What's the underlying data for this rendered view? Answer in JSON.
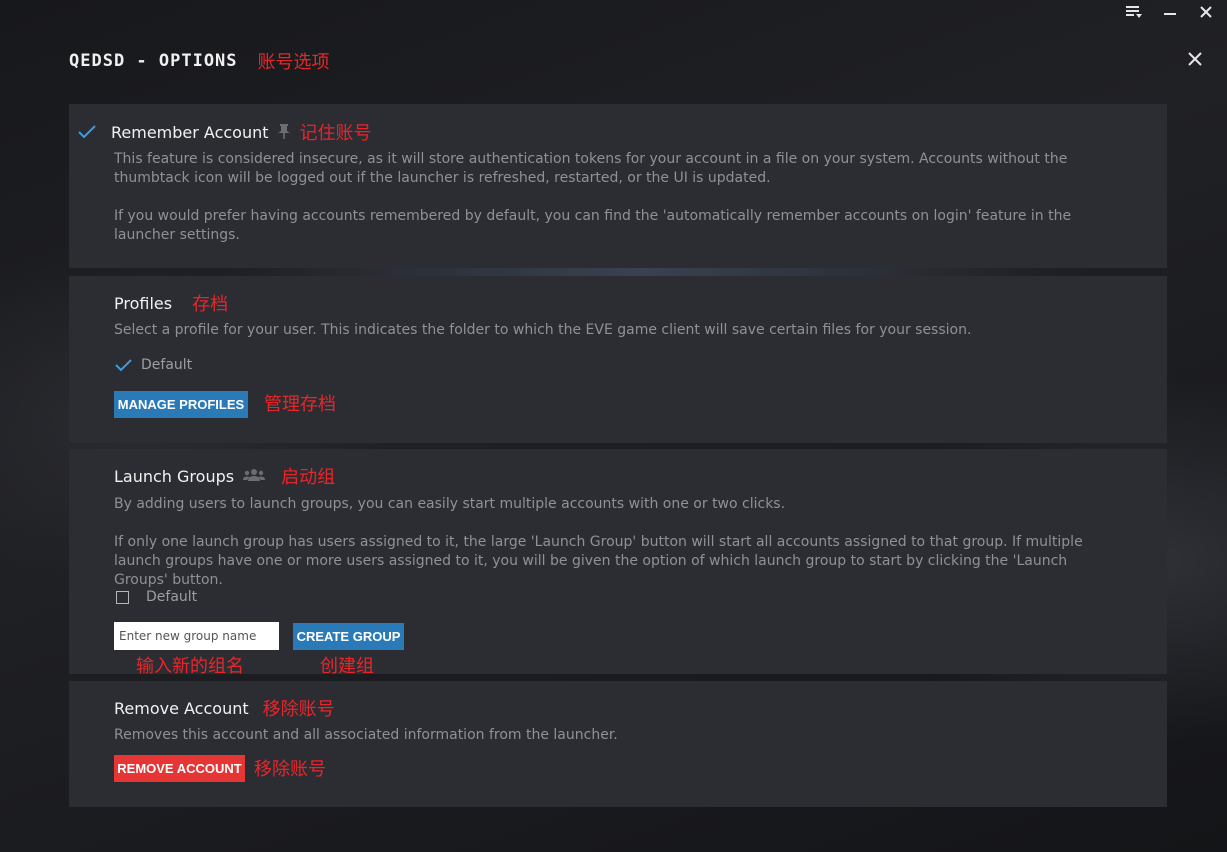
{
  "window": {
    "title": "QEDSD - OPTIONS",
    "title_annotation": "账号选项",
    "controls": [
      "menu-icon",
      "minimize-icon",
      "close-icon"
    ]
  },
  "remember": {
    "label": "Remember Account",
    "annotation": "记住账号",
    "checked": true,
    "desc1": "This feature is considered insecure, as it will store authentication tokens for your account in a file on your system. Accounts without the thumbtack icon will be logged out if the launcher is refreshed, restarted, or the UI is updated.",
    "desc2": "If you would prefer having accounts remembered by default, you can find the 'automatically remember accounts on login' feature in the launcher settings."
  },
  "profiles": {
    "label": "Profiles",
    "annotation": "存档",
    "desc": "Select a profile for your user. This indicates the folder to which the EVE game client will save certain files for your session.",
    "option_label": "Default",
    "option_checked": true,
    "button_label": "MANAGE PROFILES",
    "button_annotation": "管理存档"
  },
  "launch_groups": {
    "label": "Launch Groups",
    "annotation": "启动组",
    "desc1": "By adding users to launch groups, you can easily start multiple accounts with one or two clicks.",
    "desc2": "If only one launch group has users assigned to it, the large 'Launch Group' button will start all accounts assigned to that group. If multiple launch groups have one or more users assigned to it, you will be given the option of which launch group to start by clicking the 'Launch Groups' button.",
    "option_label": "Default",
    "option_checked": false,
    "input_placeholder": "Enter new group name",
    "input_value": "",
    "input_annotation": "输入新的组名",
    "button_label": "CREATE GROUP",
    "button_annotation": "创建组"
  },
  "remove": {
    "label": "Remove Account",
    "annotation": "移除账号",
    "desc": "Removes this account and all associated information from the launcher.",
    "button_label": "REMOVE ACCOUNT",
    "button_annotation": "移除账号"
  },
  "colors": {
    "accent_blue": "#2a7ab8",
    "danger_red": "#e63535",
    "annotation_red": "#e8262a",
    "panel": "#2c2d33",
    "check_blue": "#3b9ddf"
  }
}
